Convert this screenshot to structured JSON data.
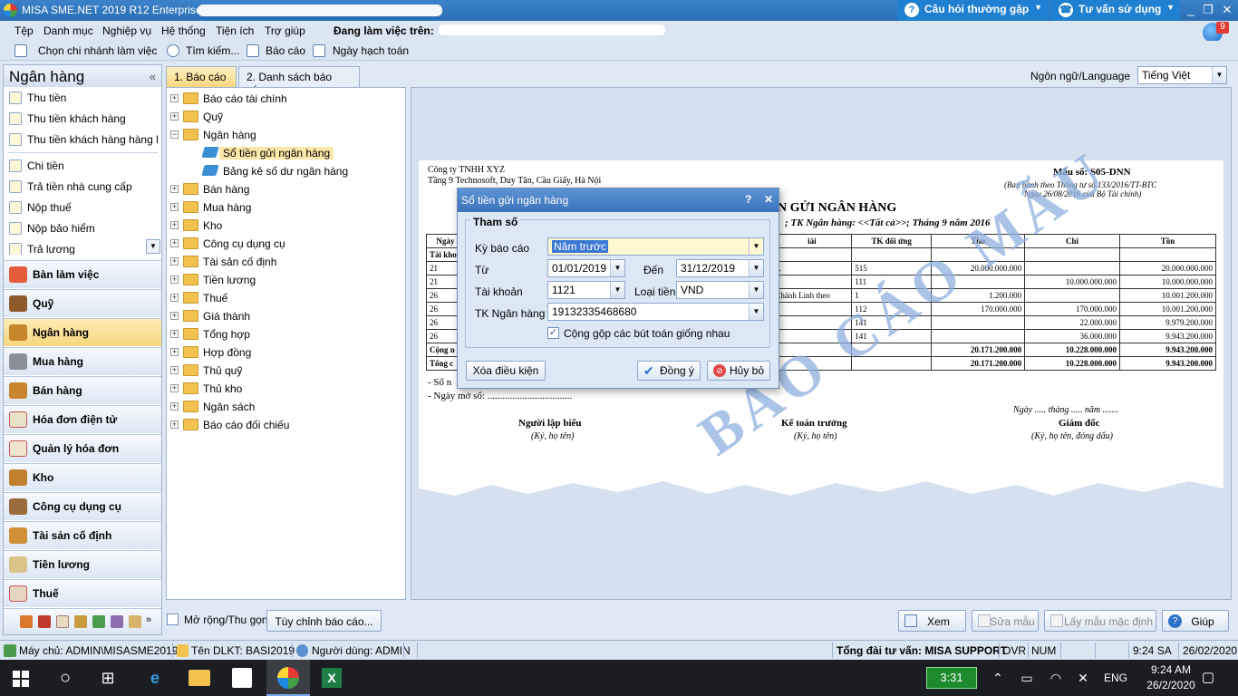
{
  "titlebar": {
    "title": "MISA SME.NET 2019 R12 Enterprise",
    "faq": "Câu hỏi thường gặp",
    "support": "Tư vấn sử dụng",
    "minimize": "_",
    "restore": "❐",
    "close": "✕"
  },
  "menu": {
    "items": [
      "Tệp",
      "Danh mục",
      "Nghiệp vụ",
      "Hệ thống",
      "Tiện ích",
      "Trợ giúp"
    ],
    "working_on": "Đang làm việc trên:",
    "notif_count": "9"
  },
  "toolbar": {
    "branch": "Chọn chi nhánh làm việc",
    "search": "Tìm kiếm...",
    "report": "Báo cáo",
    "posting_date": "Ngày hạch toán"
  },
  "left": {
    "title": "Ngân hàng",
    "collapse": "«",
    "group1": [
      "Thu tiền",
      "Thu tiền khách hàng",
      "Thu tiền khách hàng hàng l..."
    ],
    "group2": [
      "Chi tiền",
      "Trả tiền nhà cung cấp",
      "Nộp thuế",
      "Nộp bảo hiểm",
      "Trả lương"
    ],
    "nav": [
      "Bàn làm việc",
      "Quỹ",
      "Ngân hàng",
      "Mua hàng",
      "Bán hàng",
      "Hóa đơn điện tử",
      "Quản lý hóa đơn",
      "Kho",
      "Công cụ dụng cụ",
      "Tài sản cố định",
      "Tiền lương",
      "Thuế"
    ]
  },
  "tabs": {
    "report": "1. Báo cáo",
    "report_list": "2. Danh sách báo cáo"
  },
  "language": {
    "label": "Ngôn ngữ/Language",
    "value": "Tiếng Việt"
  },
  "tree": [
    {
      "label": "Báo cáo tài chính",
      "type": "folder",
      "level": 0,
      "pm": "+"
    },
    {
      "label": "Quỹ",
      "type": "folder",
      "level": 0,
      "pm": "+"
    },
    {
      "label": "Ngân hàng",
      "type": "folder",
      "level": 0,
      "pm": "−"
    },
    {
      "label": "Sổ tiền gửi ngân hàng",
      "type": "report",
      "level": 1,
      "selected": true
    },
    {
      "label": "Bảng kê số dư ngân hàng",
      "type": "report",
      "level": 1
    },
    {
      "label": "Bán hàng",
      "type": "folder",
      "level": 0,
      "pm": "+"
    },
    {
      "label": "Mua hàng",
      "type": "folder",
      "level": 0,
      "pm": "+"
    },
    {
      "label": "Kho",
      "type": "folder",
      "level": 0,
      "pm": "+"
    },
    {
      "label": "Công cụ dụng cụ",
      "type": "folder",
      "level": 0,
      "pm": "+"
    },
    {
      "label": "Tài sản cố định",
      "type": "folder",
      "level": 0,
      "pm": "+"
    },
    {
      "label": "Tiền lương",
      "type": "folder",
      "level": 0,
      "pm": "+"
    },
    {
      "label": "Thuế",
      "type": "folder",
      "level": 0,
      "pm": "+"
    },
    {
      "label": "Giá thành",
      "type": "folder",
      "level": 0,
      "pm": "+"
    },
    {
      "label": "Tổng hợp",
      "type": "folder",
      "level": 0,
      "pm": "+"
    },
    {
      "label": "Hợp đồng",
      "type": "folder",
      "level": 0,
      "pm": "+"
    },
    {
      "label": "Thủ quỹ",
      "type": "folder",
      "level": 0,
      "pm": "+"
    },
    {
      "label": "Thủ kho",
      "type": "folder",
      "level": 0,
      "pm": "+"
    },
    {
      "label": "Ngân sách",
      "type": "folder",
      "level": 0,
      "pm": "+"
    },
    {
      "label": "Báo cáo đối chiếu",
      "type": "folder",
      "level": 0,
      "pm": "+"
    }
  ],
  "report": {
    "company": "Công ty TNHH XYZ",
    "address": "Tầng 9 Technosoft, Duy Tân, Cầu Giấy, Hà Nội",
    "form_no": "Mẫu số: S05-DNN",
    "circular": "(Ban hành theo Thông tư số 133/2016/TT-BTC",
    "circular_date": "Ngày 26/08/2016 của Bộ Tài chính)",
    "title": "N GỬI NGÂN HÀNG",
    "subtitle": "; TK Ngân hàng: <<Tất cả>>; Tháng 9 năm 2016",
    "watermark": "BÁO CÁO MẪU",
    "headers": [
      "Ngày",
      "",
      "iải",
      "TK đối ứng",
      "Thu",
      "Chi",
      "Tồn"
    ],
    "rows": [
      [
        "Tài khoả",
        "",
        "",
        "",
        "",
        "",
        ""
      ],
      [
        "21",
        "",
        "...",
        "515",
        "20.000.000.000",
        "",
        "20.000.000.000"
      ],
      [
        "21",
        "",
        "ỹ",
        "111",
        "",
        "10.000.000.000",
        "10.000.000.000"
      ],
      [
        "26",
        "",
        "Chánh Linh theo",
        "1",
        "1.200.000",
        "",
        "10.001.200.000"
      ],
      [
        "26",
        "",
        "",
        "112",
        "170.000.000",
        "170.000.000",
        "10.001.200.000"
      ],
      [
        "26",
        "",
        "",
        "141",
        "",
        "22.000.000",
        "9.979.200.000"
      ],
      [
        "26",
        "",
        "",
        "141",
        "",
        "36.000.000",
        "9.943.200.000"
      ],
      [
        "Cộng n",
        "",
        "",
        "",
        "20.171.200.000",
        "10.228.000.000",
        "9.943.200.000"
      ],
      [
        "Tổng c",
        "",
        "",
        "",
        "20.171.200.000",
        "10.228.000.000",
        "9.943.200.000"
      ]
    ],
    "note1": "- Sổ n",
    "note2": "- Ngày mở sổ: ..................................",
    "date_line": "Ngày ..... tháng ..... năm .......",
    "sign": [
      {
        "title": "Người lập biểu",
        "sub": "(Ký, họ tên)"
      },
      {
        "title": "Kế toán trưởng",
        "sub": "(Ký, họ tên)"
      },
      {
        "title": "Giám đốc",
        "sub": "(Ký, họ tên, đóng dấu)"
      }
    ]
  },
  "dialog": {
    "title": "Sổ tiền gửi ngân hàng",
    "help": "?",
    "close": "✕",
    "group": "Tham số",
    "period_label": "Kỳ báo cáo",
    "period": "Năm trước",
    "from_label": "Từ",
    "from": "01/01/2019",
    "to_label": "Đến",
    "to": "31/12/2019",
    "account_label": "Tài khoản",
    "account": "1121",
    "currency_label": "Loại tiền",
    "currency": "VND",
    "bank_label": "TK Ngân hàng",
    "bank": "19132335468680",
    "merge": "Cộng gộp các bút toán giống nhau",
    "clear": "Xóa điều kiện",
    "ok": "Đồng ý",
    "cancel": "Hủy bỏ"
  },
  "bottom": {
    "expand": "Mở rộng/Thu gọn",
    "customize": "Tùy chỉnh báo cáo...",
    "view": "Xem",
    "edit_template": "Sửa mẫu",
    "default_template": "Lấy mẫu mặc định",
    "help": "Giúp"
  },
  "status": {
    "server": "Máy chủ: ADMIN\\MISASME2019",
    "db": "Tên DLKT: BASI2019",
    "user": "Người dùng: ADMIN",
    "hotline": "Tổng đài tư vấn: MISA SUPPORT",
    "ovr": "OVR",
    "num": "NUM",
    "time": "9:24 SA",
    "date": "26/02/2020"
  },
  "taskbar": {
    "battery": "3:31",
    "lang": "ENG",
    "clock_time": "9:24 AM",
    "clock_date": "26/2/2020",
    "excel": "X"
  }
}
